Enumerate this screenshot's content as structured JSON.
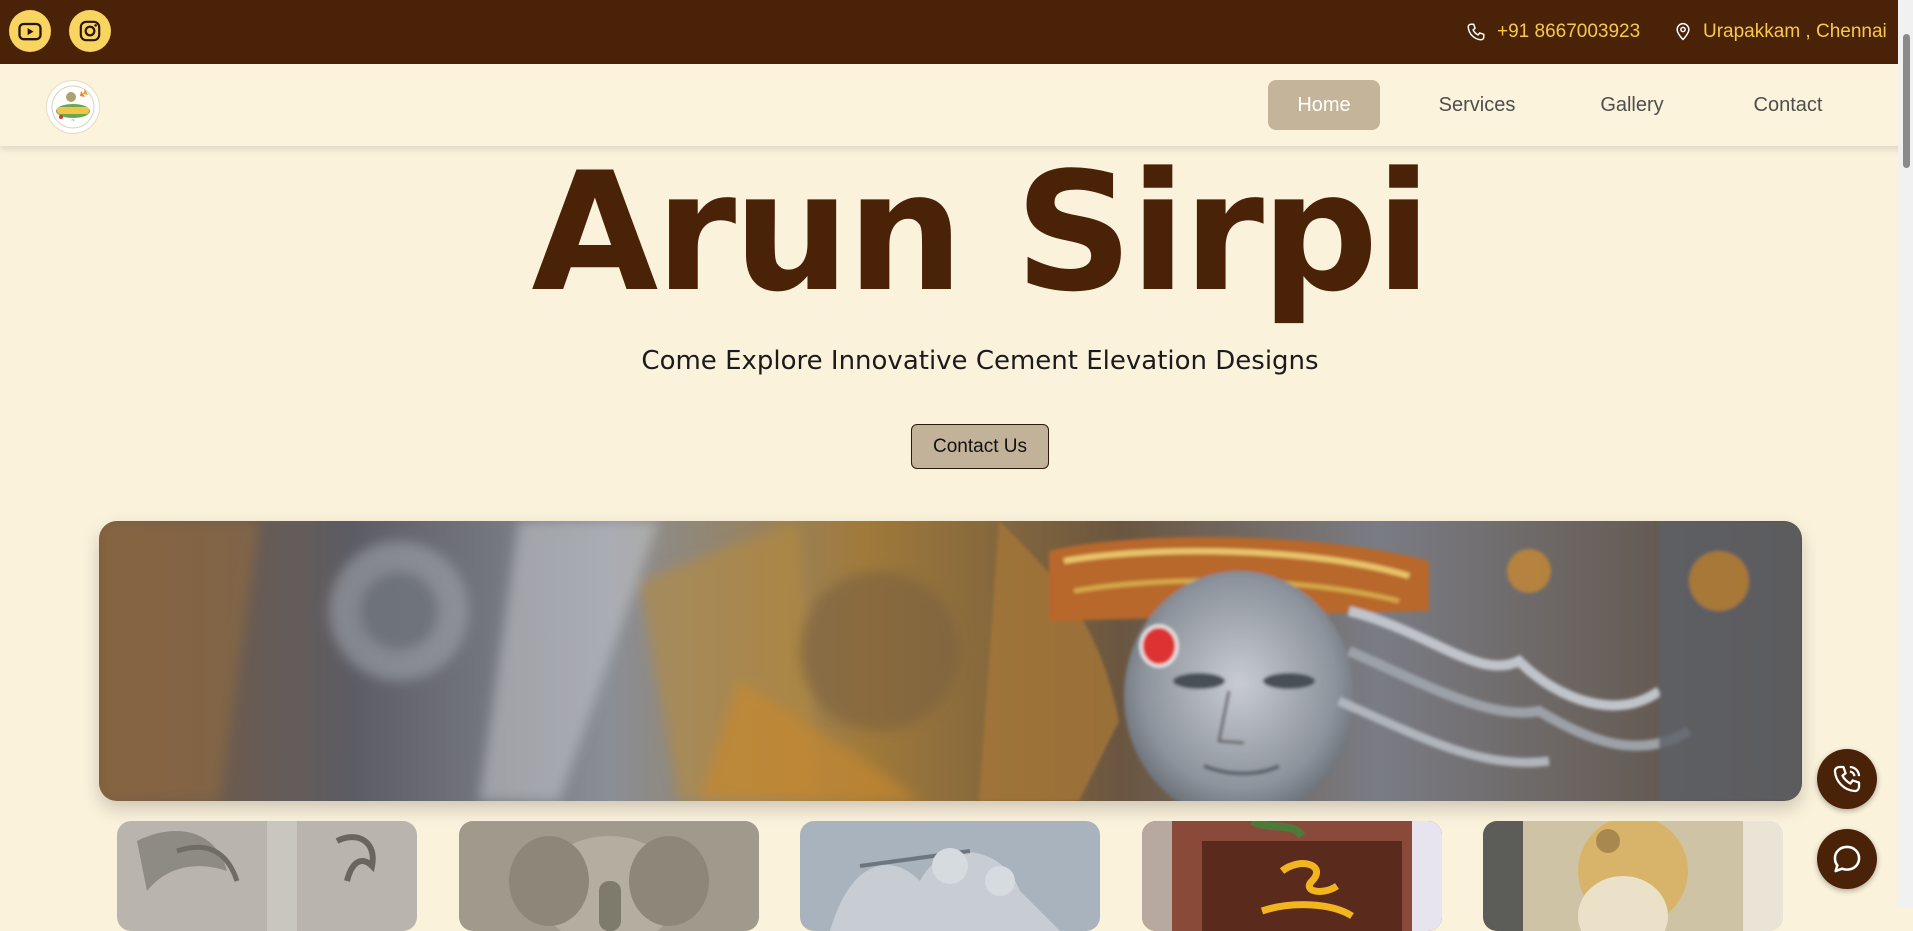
{
  "topbar": {
    "phone": "+91 8667003923",
    "location": "Urapakkam , Chennai",
    "social": [
      "youtube-icon",
      "instagram-icon"
    ]
  },
  "nav": {
    "items": [
      {
        "label": "Home",
        "active": true
      },
      {
        "label": "Services",
        "active": false
      },
      {
        "label": "Gallery",
        "active": false
      },
      {
        "label": "Contact",
        "active": false
      }
    ]
  },
  "hero": {
    "title": "Arun Sirpi",
    "subtitle": "Come Explore Innovative Cement Elevation Designs",
    "cta": "Contact Us"
  },
  "floating": {
    "call": "phone-call-icon",
    "chat": "chat-icon"
  },
  "colors": {
    "brand": "#4a2208",
    "accent": "#f7c948",
    "background": "#fbf2dc",
    "nav_active": "#c4b49a"
  }
}
